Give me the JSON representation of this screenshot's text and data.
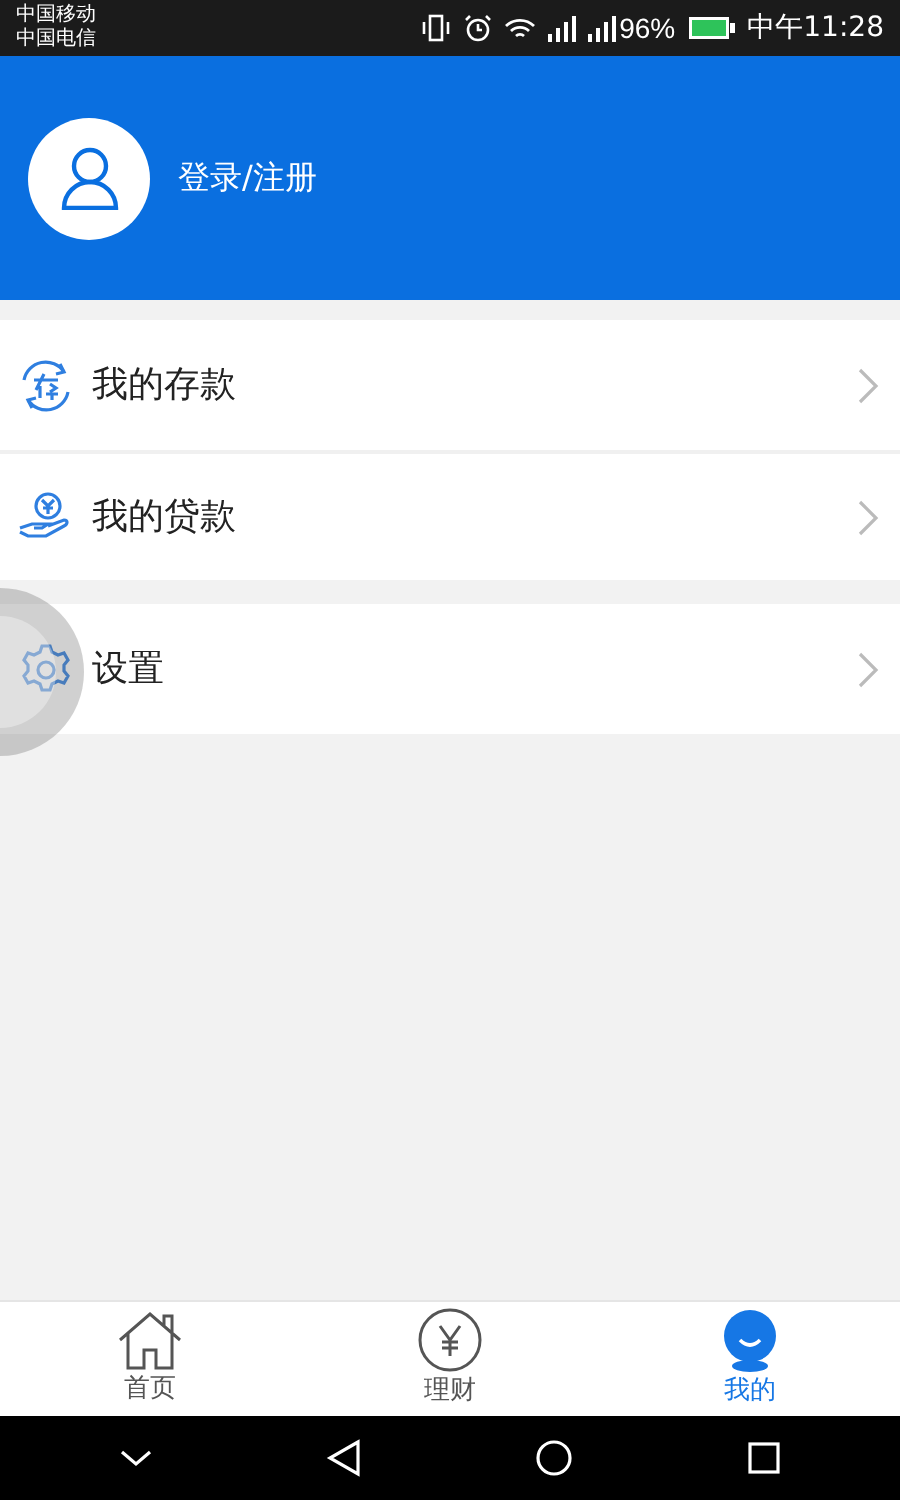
{
  "status_bar": {
    "carriers": [
      "中国移动",
      "中国电信"
    ],
    "battery": "96%",
    "time": "中午11:28"
  },
  "header": {
    "login_label": "登录/注册"
  },
  "menu_groups": [
    [
      {
        "kind": "deposit",
        "label": "我的存款"
      },
      {
        "kind": "loan",
        "label": "我的贷款"
      }
    ],
    [
      {
        "kind": "settings",
        "label": "设置"
      }
    ]
  ],
  "tabs": [
    {
      "kind": "home",
      "label": "首页",
      "selected": false
    },
    {
      "kind": "finance",
      "label": "理财",
      "selected": false
    },
    {
      "kind": "me",
      "label": "我的",
      "selected": true
    }
  ]
}
